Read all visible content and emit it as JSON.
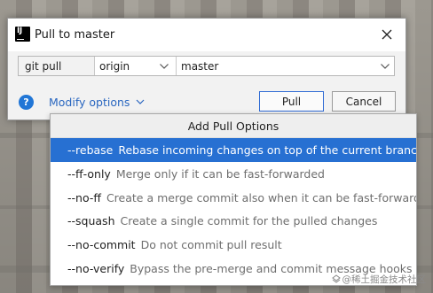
{
  "window": {
    "title": "Pull to master"
  },
  "command": {
    "git_cmd": "git pull",
    "remote": "origin",
    "branch": "master"
  },
  "actions": {
    "modify_options": "Modify options",
    "pull": "Pull",
    "cancel": "Cancel",
    "help": "?"
  },
  "popup": {
    "title": "Add Pull Options",
    "options": [
      {
        "flag": "--rebase",
        "desc": "Rebase incoming changes on top of the current branch",
        "selected": true
      },
      {
        "flag": "--ff-only",
        "desc": "Merge only if it can be fast-forwarded",
        "selected": false
      },
      {
        "flag": "--no-ff",
        "desc": "Create a merge commit also when it can be fast-forwarded",
        "selected": false
      },
      {
        "flag": "--squash",
        "desc": "Create a single commit for the pulled changes",
        "selected": false
      },
      {
        "flag": "--no-commit",
        "desc": "Do not commit pull result",
        "selected": false
      },
      {
        "flag": "--no-verify",
        "desc": "Bypass the pre-merge and commit message hooks",
        "selected": false
      }
    ]
  },
  "watermark": "@稀土掘金技术社区",
  "icons": {
    "app": "intellij-idea-icon",
    "close": "close-icon",
    "help": "help-icon",
    "dropdown": "chevron-down-icon"
  },
  "colors": {
    "accent": "#2770d2",
    "link": "#2a67c0",
    "help": "#2176d6"
  }
}
